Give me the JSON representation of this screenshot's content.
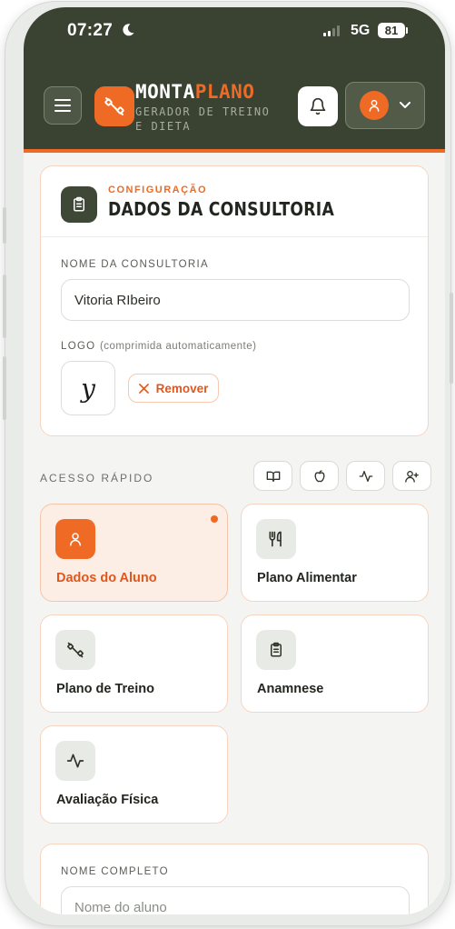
{
  "status_bar": {
    "time": "07:27",
    "network": "5G",
    "battery": "81"
  },
  "header": {
    "brand_part1": "MONTA",
    "brand_part2": "PLANO",
    "subtitle": "GERADOR DE TREINO E DIETA",
    "colors": {
      "header_bg": "#3a4232",
      "accent": "#ef6a24"
    }
  },
  "config": {
    "kicker": "CONFIGURAÇÃO",
    "title": "DADOS DA CONSULTORIA",
    "name_label": "NOME DA CONSULTORIA",
    "name_value": "Vitoria RIbeiro",
    "logo_label": "LOGO",
    "logo_hint": "(comprimida automaticamente)",
    "logo_glyph": "y",
    "remove_label": "Remover"
  },
  "quick_access": {
    "label": "ACESSO RÁPIDO",
    "icons": [
      "book-icon",
      "apple-icon",
      "activity-icon",
      "user-plus-icon"
    ]
  },
  "tiles": [
    {
      "label": "Dados do Aluno",
      "icon": "user-icon",
      "active": true
    },
    {
      "label": "Plano Alimentar",
      "icon": "utensils-icon",
      "active": false
    },
    {
      "label": "Plano de Treino",
      "icon": "dumbbell-icon",
      "active": false
    },
    {
      "label": "Anamnese",
      "icon": "clipboard-icon",
      "active": false
    },
    {
      "label": "Avaliação Física",
      "icon": "activity-icon",
      "active": false
    }
  ],
  "student": {
    "name_label": "NOME COMPLETO",
    "name_placeholder": "Nome do aluno"
  }
}
